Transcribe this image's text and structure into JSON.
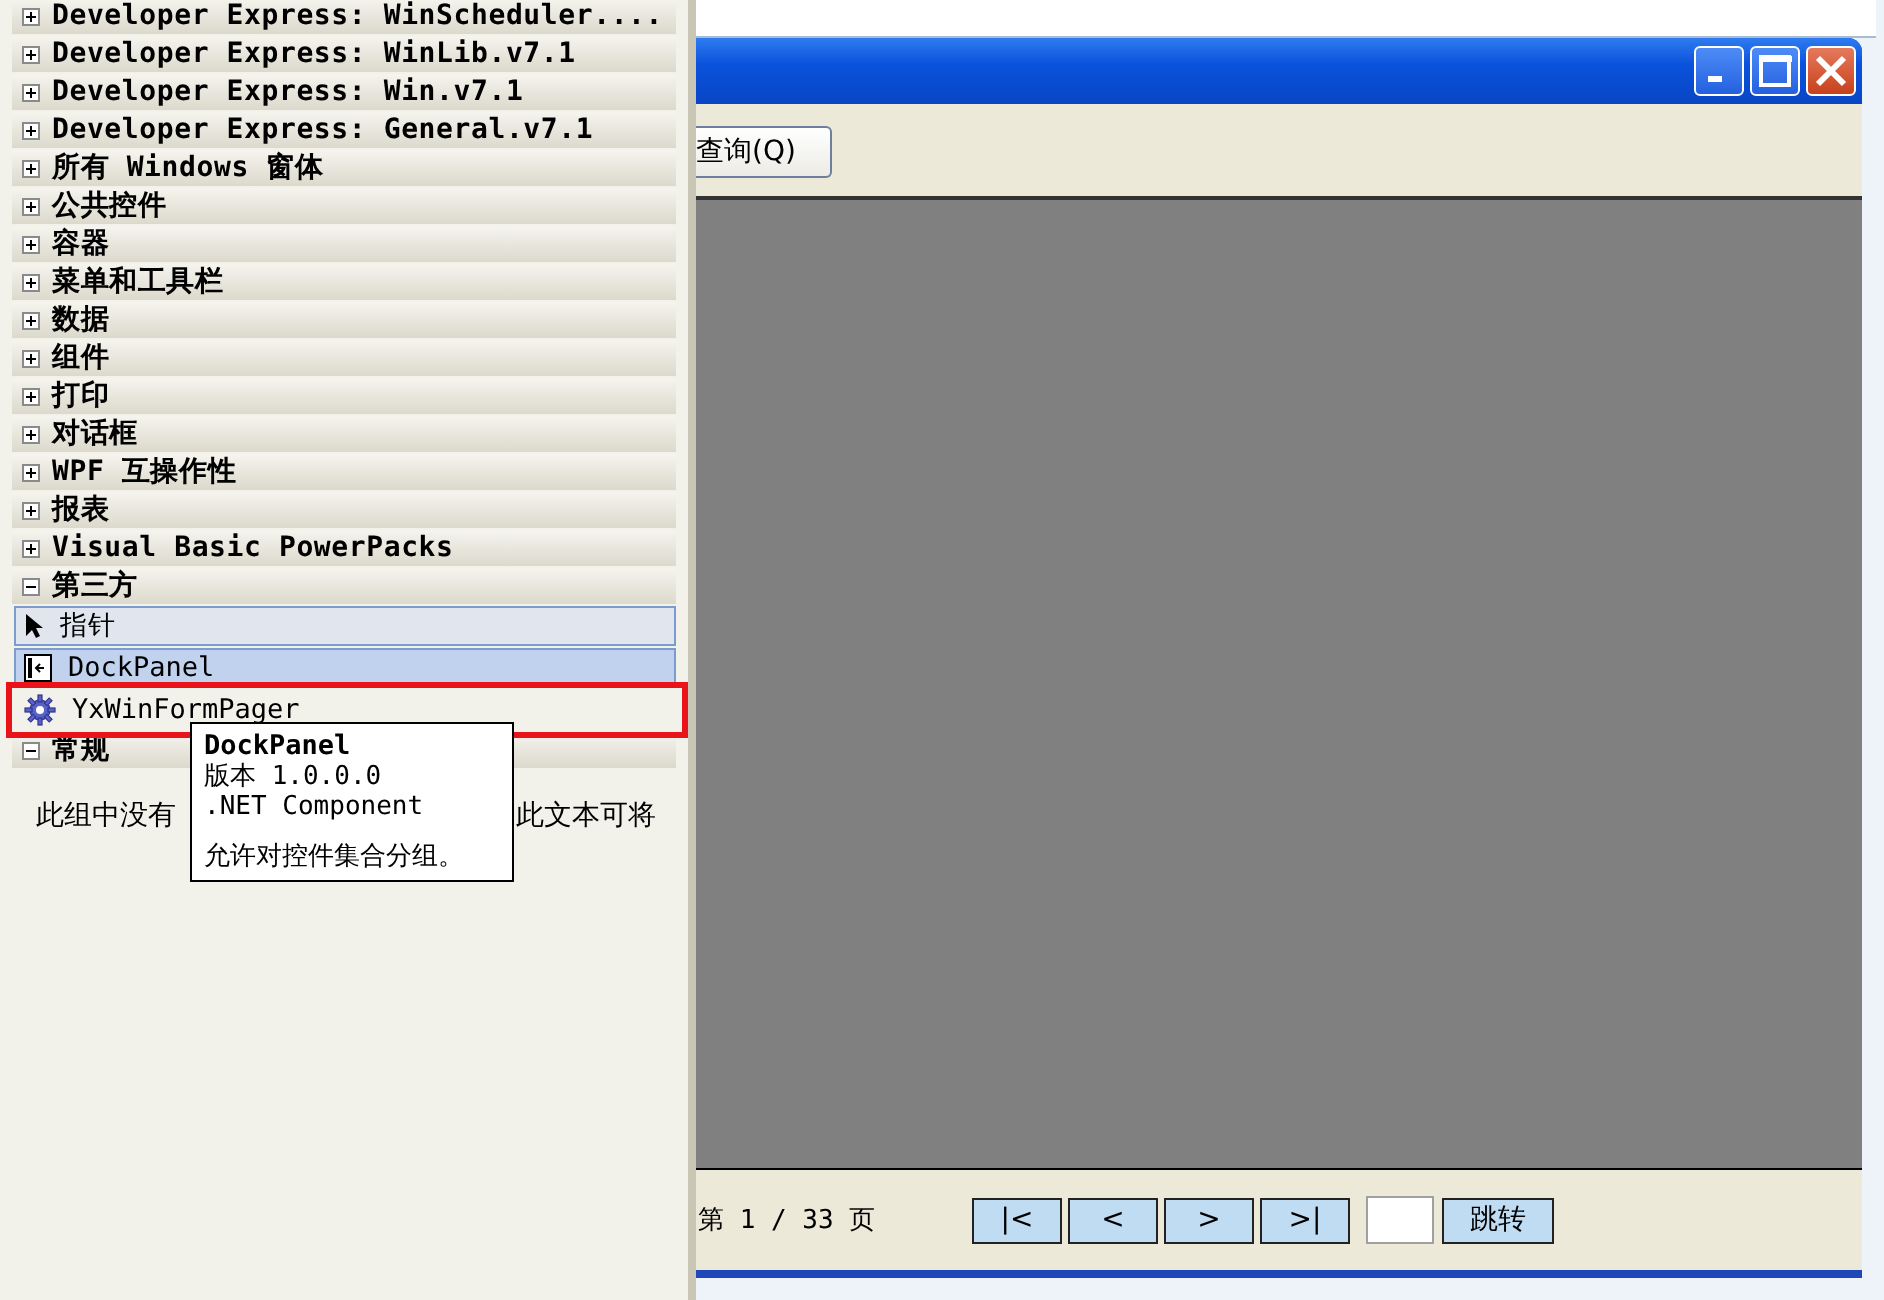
{
  "toolbox": {
    "groups": [
      {
        "label": "Developer Express: WinScheduler....",
        "expanded": false
      },
      {
        "label": "Developer Express: WinLib.v7.1",
        "expanded": false
      },
      {
        "label": "Developer Express: Win.v7.1",
        "expanded": false
      },
      {
        "label": "Developer Express: General.v7.1",
        "expanded": false
      },
      {
        "label": "所有 Windows 窗体",
        "expanded": false
      },
      {
        "label": "公共控件",
        "expanded": false
      },
      {
        "label": "容器",
        "expanded": false
      },
      {
        "label": "菜单和工具栏",
        "expanded": false
      },
      {
        "label": "数据",
        "expanded": false
      },
      {
        "label": "组件",
        "expanded": false
      },
      {
        "label": "打印",
        "expanded": false
      },
      {
        "label": "对话框",
        "expanded": false
      },
      {
        "label": "WPF 互操作性",
        "expanded": false
      },
      {
        "label": "报表",
        "expanded": false
      },
      {
        "label": "Visual Basic PowerPacks",
        "expanded": false
      },
      {
        "label": "第三方",
        "expanded": true,
        "items": [
          {
            "label": "指针",
            "kind": "pointer",
            "selected": true,
            "hovered": false,
            "marked": false
          },
          {
            "label": "DockPanel",
            "kind": "panel",
            "selected": false,
            "hovered": true,
            "marked": false
          },
          {
            "label": "YxWinFormPager",
            "kind": "gear",
            "selected": false,
            "hovered": false,
            "marked": true
          }
        ]
      },
      {
        "label": "常规",
        "expanded": true,
        "empty_text": [
          "此组中没有",
          "此文本可将"
        ]
      }
    ]
  },
  "tooltip": {
    "title": "DockPanel",
    "lines": [
      "版本 1.0.0.0",
      ".NET Component"
    ],
    "description": "允许对控件集合分组。"
  },
  "window": {
    "query_button": "查询(Q)",
    "pager": {
      "page_label": "第 1 / 33 页",
      "buttons": [
        "|<",
        "<",
        ">",
        ">|"
      ],
      "go_button": "跳转"
    }
  }
}
